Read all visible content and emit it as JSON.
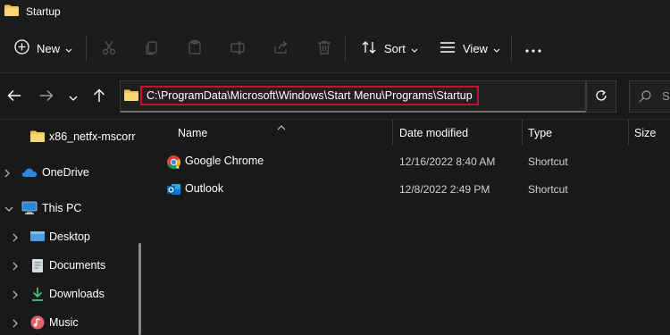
{
  "window": {
    "title": "Startup"
  },
  "commandbar": {
    "new_label": "New",
    "sort_label": "Sort",
    "view_label": "View",
    "icons": [
      "plus-circle-icon",
      "cut-icon",
      "copy-icon",
      "paste-icon",
      "rename-icon",
      "share-icon",
      "delete-icon",
      "sort-icon",
      "view-icon",
      "more-icon"
    ]
  },
  "address": {
    "path": "C:\\ProgramData\\Microsoft\\Windows\\Start Menu\\Programs\\Startup",
    "search_placeholder": "S",
    "highlight_color": "#c8102e"
  },
  "navpane": {
    "items": [
      {
        "label": "x86_netfx-mscorr",
        "icon": "folder-icon"
      },
      {
        "label": "OneDrive",
        "icon": "onedrive-icon"
      },
      {
        "label": "This PC",
        "icon": "pc-icon"
      },
      {
        "label": "Desktop",
        "icon": "desktop-icon"
      },
      {
        "label": "Documents",
        "icon": "documents-icon"
      },
      {
        "label": "Downloads",
        "icon": "downloads-icon"
      },
      {
        "label": "Music",
        "icon": "music-icon"
      }
    ]
  },
  "filelist": {
    "columns": [
      "Name",
      "Date modified",
      "Type",
      "Size"
    ],
    "rows": [
      {
        "name": "Google Chrome",
        "date": "12/16/2022 8:40 AM",
        "type": "Shortcut",
        "icon": "chrome-icon"
      },
      {
        "name": "Outlook",
        "date": "12/8/2022 2:49 PM",
        "type": "Shortcut",
        "icon": "outlook-icon"
      }
    ]
  },
  "colors": {
    "background": "#191919",
    "folder": "#f2c24b",
    "accent": "#4ca0e0"
  }
}
